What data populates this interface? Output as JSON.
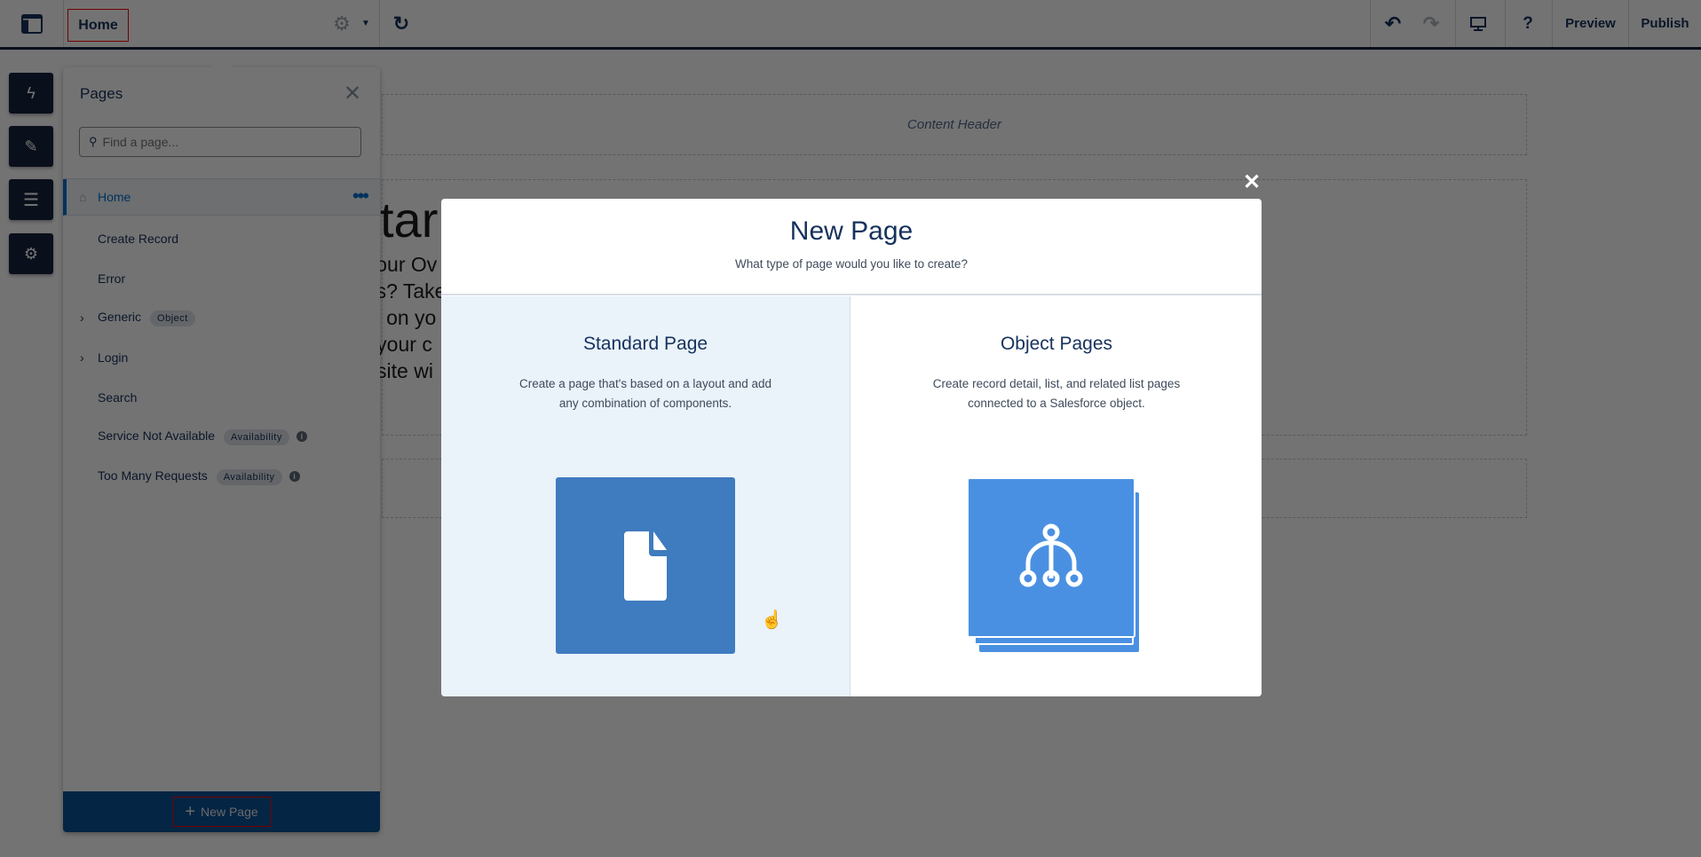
{
  "topbar": {
    "home_tab": "Home",
    "preview": "Preview",
    "publish": "Publish",
    "icons": [
      "layout-icon",
      "gear-icon",
      "caret-down-icon",
      "refresh-icon",
      "undo-icon",
      "redo-icon",
      "desktop-icon",
      "help-icon"
    ]
  },
  "rail": {
    "icons": [
      "lightning-icon",
      "brush-icon",
      "list-icon",
      "gear-icon"
    ]
  },
  "background": {
    "content_header": "Content Header",
    "heading_fragment": "tar",
    "text_fragments": [
      "Your Ov",
      "ges? Take",
      "nts on yo",
      "e your c",
      "r site wi"
    ]
  },
  "pages_panel": {
    "title": "Pages",
    "search_placeholder": "Find a page...",
    "items": [
      {
        "label": "Home",
        "selected": true
      },
      {
        "label": "Create Record"
      },
      {
        "label": "Error"
      },
      {
        "label": "Generic",
        "badge": "Object",
        "expandable": true
      },
      {
        "label": "Login",
        "expandable": true
      },
      {
        "label": "Search"
      },
      {
        "label": "Service Not Available",
        "badge": "Availability",
        "info": true
      },
      {
        "label": "Too Many Requests",
        "badge": "Availability",
        "info": true
      }
    ],
    "new_page": "New Page"
  },
  "modal": {
    "title": "New Page",
    "subtitle": "What type of page would you like to create?",
    "options": [
      {
        "title": "Standard Page",
        "description_line1": "Create a page that's based on a layout and add",
        "description_line2": "any combination of components.",
        "icon": "document-icon",
        "color": "#3f7bbf"
      },
      {
        "title": "Object Pages",
        "description_line1": "Create record detail, list, and related list pages",
        "description_line2": "connected to a Salesforce object.",
        "icon": "hierarchy-icon",
        "color": "#4a90e2"
      }
    ]
  },
  "colors": {
    "accent": "#0070d2",
    "dark": "#16213e",
    "hover_bg": "#eaf2fa"
  }
}
